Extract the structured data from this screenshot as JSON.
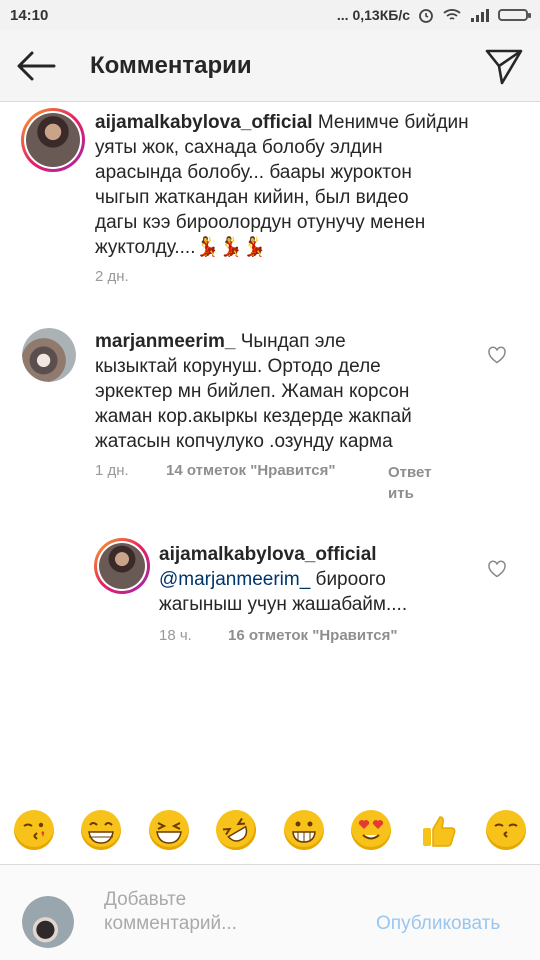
{
  "status_bar": {
    "time": "14:10",
    "speed": "... 0,13КБ/с"
  },
  "header": {
    "title": "Комментарии"
  },
  "comments": [
    {
      "username": "aijamalkabylova_official",
      "text_first": "Менимче бийдин",
      "lines": [
        "уяты жок, сахнада болобу элдин",
        "арасында болобу... баары журоктон",
        "чыгып жаткандан кийин, был видео",
        "дагы кээ бироолордун отунучу менен",
        "жуктолду....💃💃💃"
      ],
      "time": "2 дн."
    },
    {
      "username": "marjanmeerim_",
      "text_first": "Чындап эле",
      "lines": [
        "кызыктай корунуш. Ортодо деле",
        "эркектер мн бийлеп. Жаман корсон",
        "жаман кор.акыркы кездерде жакпай",
        "жатасын копчулуко .озунду карма"
      ],
      "time": "1 дн.",
      "likes": "14 отметок \"Нравится\"",
      "reply_line1": "Ответ",
      "reply_line2": "ить"
    },
    {
      "username": "aijamalkabylova_official",
      "mention": "@marjanmeerim_",
      "text_after_mention": " бироого",
      "lines": [
        "жагыныш учун жашабайм...."
      ],
      "time": "18 ч.",
      "likes": "16 отметок \"Нравится\""
    }
  ],
  "emoji_bar": [
    "kissing-face",
    "grinning-face",
    "laughing-face",
    "rolling-laughing-face",
    "grimacing-face",
    "heart-eyes-face",
    "thumbs-up",
    "kissing-closed-eyes-face"
  ],
  "composer": {
    "placeholder_line1": "Добавьте",
    "placeholder_line2": "комментарий...",
    "publish": "Опубликовать"
  }
}
